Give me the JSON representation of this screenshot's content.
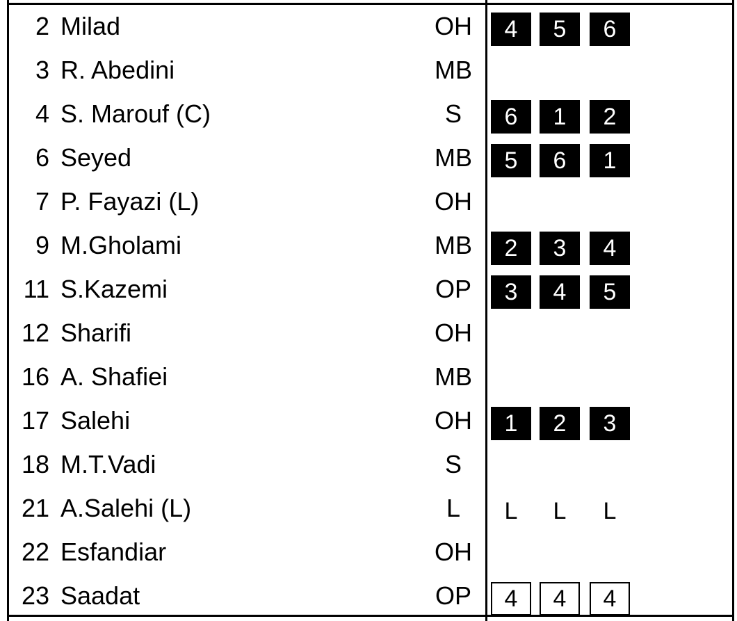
{
  "players": [
    {
      "number": "2",
      "name": "Milad",
      "position": "OH",
      "rotations": [
        "4",
        "5",
        "6"
      ],
      "style": "filled"
    },
    {
      "number": "3",
      "name": "R. Abedini",
      "position": "MB",
      "rotations": [],
      "style": "none"
    },
    {
      "number": "4",
      "name": "S. Marouf (C)",
      "position": "S",
      "rotations": [
        "6",
        "1",
        "2"
      ],
      "style": "filled"
    },
    {
      "number": "6",
      "name": "Seyed",
      "position": "MB",
      "rotations": [
        "5",
        "6",
        "1"
      ],
      "style": "filled"
    },
    {
      "number": "7",
      "name": "P. Fayazi (L)",
      "position": "OH",
      "rotations": [],
      "style": "none"
    },
    {
      "number": "9",
      "name": "M.Gholami",
      "position": "MB",
      "rotations": [
        "2",
        "3",
        "4"
      ],
      "style": "filled"
    },
    {
      "number": "11",
      "name": "S.Kazemi",
      "position": "OP",
      "rotations": [
        "3",
        "4",
        "5"
      ],
      "style": "filled"
    },
    {
      "number": "12",
      "name": "Sharifi",
      "position": "OH",
      "rotations": [],
      "style": "none"
    },
    {
      "number": "16",
      "name": "A. Shafiei",
      "position": "MB",
      "rotations": [],
      "style": "none"
    },
    {
      "number": "17",
      "name": "Salehi",
      "position": "OH",
      "rotations": [
        "1",
        "2",
        "3"
      ],
      "style": "filled"
    },
    {
      "number": "18",
      "name": "M.T.Vadi",
      "position": "S",
      "rotations": [],
      "style": "none"
    },
    {
      "number": "21",
      "name": "A.Salehi (L)",
      "position": "L",
      "rotations": [
        "L",
        "L",
        "L"
      ],
      "style": "plain"
    },
    {
      "number": "22",
      "name": "Esfandiar",
      "position": "OH",
      "rotations": [],
      "style": "none"
    },
    {
      "number": "23",
      "name": "Saadat",
      "position": "OP",
      "rotations": [
        "4",
        "4",
        "4"
      ],
      "style": "outline"
    }
  ],
  "colors": {
    "text": "#000000",
    "filled_cell_bg": "#000000",
    "filled_cell_text": "#ffffff",
    "background": "#ffffff"
  }
}
